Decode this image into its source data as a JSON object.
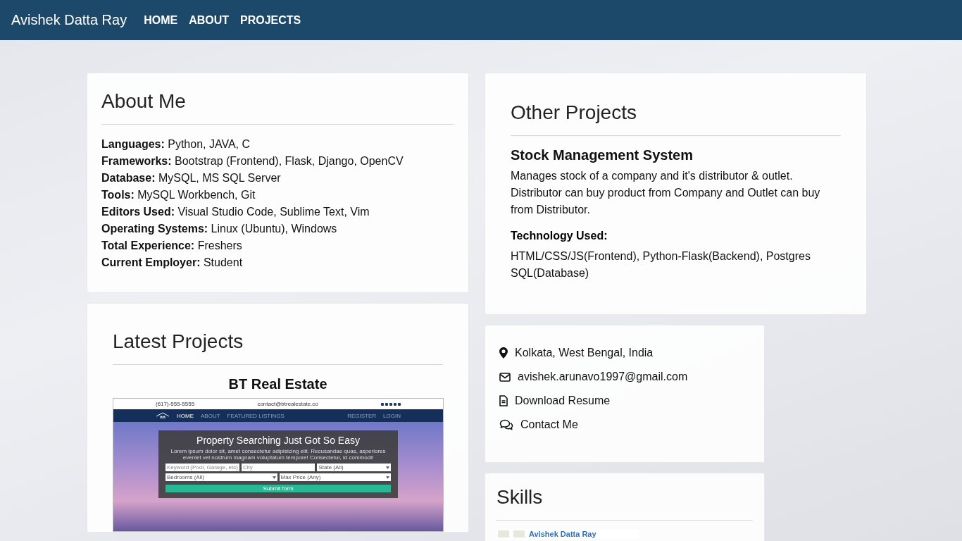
{
  "navbar": {
    "brand": "Avishek Datta Ray",
    "links": [
      {
        "label": "HOME"
      },
      {
        "label": "ABOUT"
      },
      {
        "label": "PROJECTS"
      }
    ]
  },
  "about": {
    "title": "About Me",
    "facts": [
      {
        "label": "Languages:",
        "value": "Python, JAVA, C"
      },
      {
        "label": "Frameworks:",
        "value": "Bootstrap (Frontend), Flask, Django, OpenCV"
      },
      {
        "label": "Database:",
        "value": "MySQL, MS SQL Server"
      },
      {
        "label": "Tools:",
        "value": "MySQL Workbench, Git"
      },
      {
        "label": "Editors Used:",
        "value": "Visual Studio Code, Sublime Text, Vim"
      },
      {
        "label": "Operating Systems:",
        "value": "Linux (Ubuntu), Windows"
      },
      {
        "label": "Total Experience:",
        "value": "Freshers"
      },
      {
        "label": "Current Employer:",
        "value": "Student"
      }
    ]
  },
  "other_projects": {
    "title": "Other Projects",
    "projects": [
      {
        "name": "Stock Management System",
        "description": "Manages stock of a company and it's distributor & outlet. Distributor can buy product from Company and Outlet can buy from Distributor.",
        "technology_heading": "Technology Used:",
        "technology": "HTML/CSS/JS(Frontend), Python-Flask(Backend), Postgres SQL(Database)"
      }
    ]
  },
  "latest_projects": {
    "title": "Latest Projects",
    "projects": [
      {
        "name": "BT Real Estate",
        "screenshot": {
          "phone": "(617)-555-5555",
          "email": "contact@btrealestate.co",
          "nav_links": [
            {
              "label": "HOME",
              "selected": true
            },
            {
              "label": "ABOUT",
              "selected": false
            },
            {
              "label": "FEATURED LISTINGS",
              "selected": false
            }
          ],
          "account_links": [
            "REGISTER",
            "LOGIN"
          ],
          "heading": "Property Searching Just Got So Easy",
          "text": "Lorem ipsum dolor sit, amet consectetur adipisicing elit. Recusandae quas, asperiores eveniet vel nostrum magnam voluptatum tempore! Consectetur, id commodi!",
          "fields": [
            {
              "kind": "input",
              "placeholder": "Keyword (Pool, Garage, etc)"
            },
            {
              "kind": "input",
              "placeholder": "City"
            },
            {
              "kind": "select",
              "value": "State (All)"
            },
            {
              "kind": "select",
              "value": "Bedrooms (All)"
            },
            {
              "kind": "select",
              "value": "Max Price (Any)"
            }
          ],
          "button": "Submit form"
        }
      }
    ]
  },
  "contact": {
    "items": [
      {
        "kind": "location",
        "text": "Kolkata, West Bengal, India"
      },
      {
        "kind": "email",
        "text": "avishek.arunavo1997@gmail.com"
      },
      {
        "kind": "resume",
        "text": "Download Resume"
      },
      {
        "kind": "message",
        "text": "Contact Me"
      }
    ]
  },
  "skills": {
    "title": "Skills",
    "stats_card": {
      "name": "Avishek Datta Ray"
    }
  }
}
